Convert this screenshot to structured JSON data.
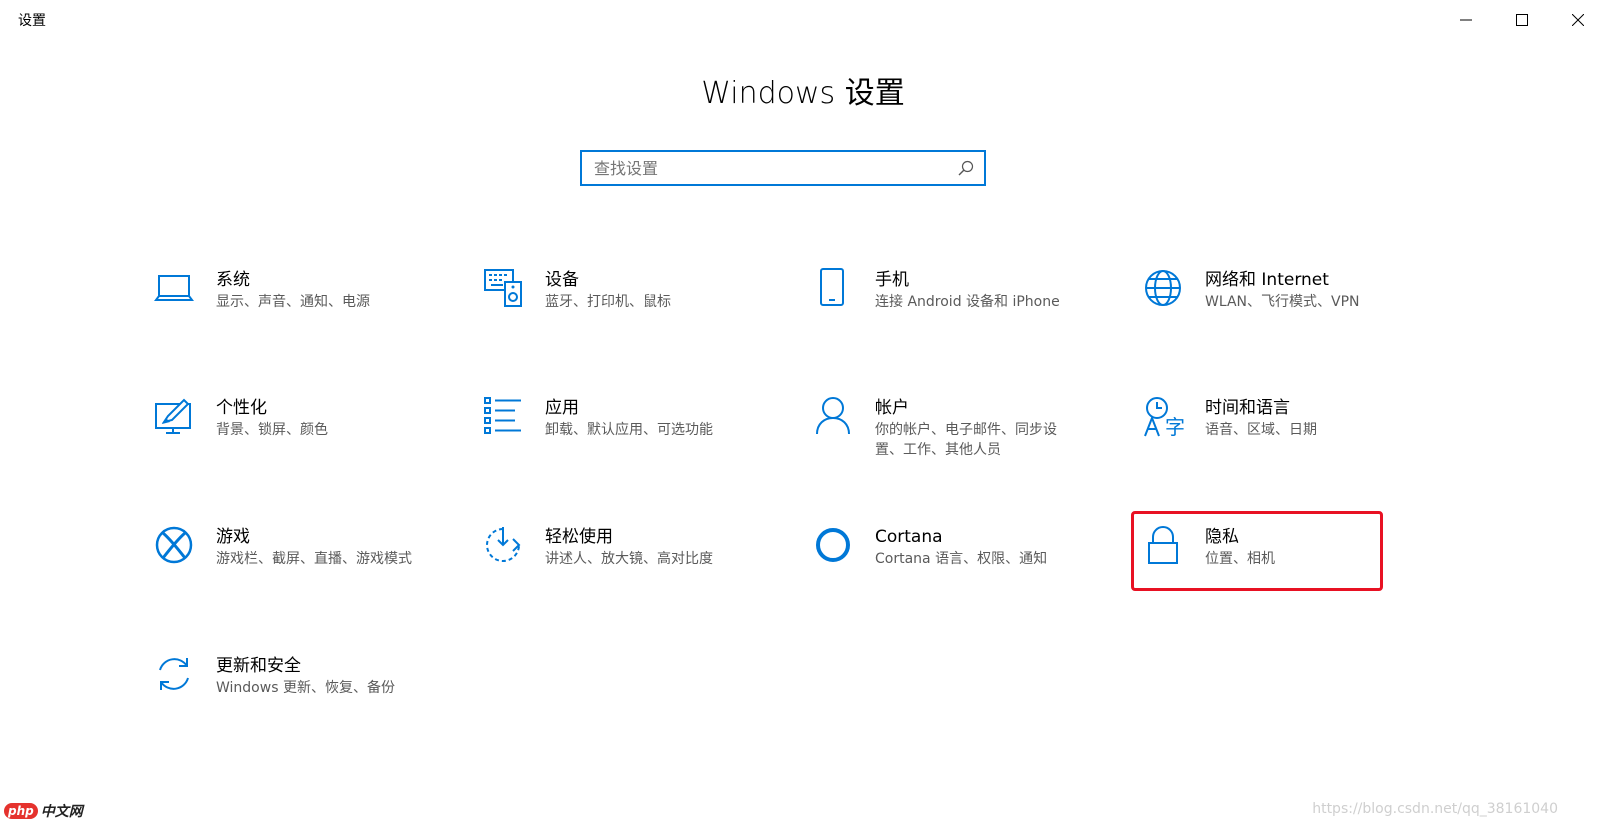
{
  "window": {
    "title": "设置",
    "controls": {
      "minimize": "minimize-icon",
      "maximize": "maximize-icon",
      "close": "close-icon"
    }
  },
  "page_title": "Windows 设置",
  "search": {
    "placeholder": "查找设置",
    "value": "",
    "icon": "search-icon"
  },
  "colors": {
    "accent": "#0078d7",
    "highlight": "#e81123",
    "desc_text": "#5a5a5a"
  },
  "tiles": [
    {
      "icon": "laptop-icon",
      "title": "系统",
      "desc": "显示、声音、通知、电源"
    },
    {
      "icon": "keyboard-speaker-icon",
      "title": "设备",
      "desc": "蓝牙、打印机、鼠标"
    },
    {
      "icon": "phone-icon",
      "title": "手机",
      "desc": "连接 Android 设备和 iPhone"
    },
    {
      "icon": "globe-icon",
      "title": "网络和 Internet",
      "desc": "WLAN、飞行模式、VPN"
    },
    {
      "icon": "personalization-icon",
      "title": "个性化",
      "desc": "背景、锁屏、颜色"
    },
    {
      "icon": "apps-list-icon",
      "title": "应用",
      "desc": "卸载、默认应用、可选功能"
    },
    {
      "icon": "person-icon",
      "title": "帐户",
      "desc": "你的帐户、电子邮件、同步设置、工作、其他人员"
    },
    {
      "icon": "time-language-icon",
      "title": "时间和语言",
      "desc": "语音、区域、日期"
    },
    {
      "icon": "xbox-icon",
      "title": "游戏",
      "desc": "游戏栏、截屏、直播、游戏模式"
    },
    {
      "icon": "ease-of-access-icon",
      "title": "轻松使用",
      "desc": "讲述人、放大镜、高对比度"
    },
    {
      "icon": "cortana-icon",
      "title": "Cortana",
      "desc": "Cortana 语言、权限、通知"
    },
    {
      "icon": "lock-icon",
      "title": "隐私",
      "desc": "位置、相机"
    },
    {
      "icon": "sync-icon",
      "title": "更新和安全",
      "desc": "Windows 更新、恢复、备份"
    }
  ],
  "watermark": {
    "url": "https://blog.csdn.net/qq_38161040",
    "logo_php": "php",
    "logo_cn": "中文网"
  }
}
